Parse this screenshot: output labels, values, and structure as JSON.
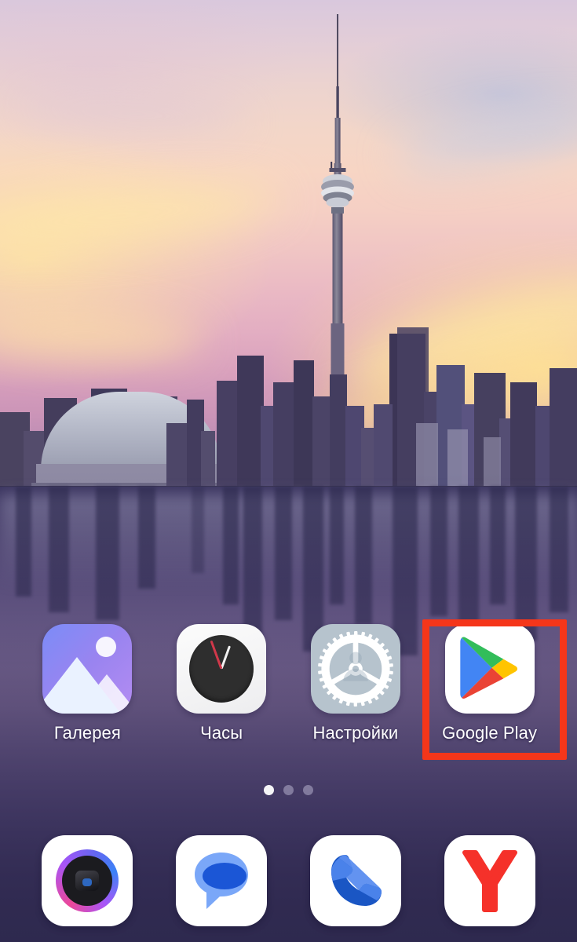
{
  "screen": {
    "type": "android-home-screen",
    "wallpaper_description": "Toronto skyline at sunset with CN Tower reflected in water",
    "background_color": "#2e2a55"
  },
  "app_grid": {
    "apps": [
      {
        "label": "Галерея",
        "icon": "gallery-icon",
        "highlighted": false
      },
      {
        "label": "Часы",
        "icon": "clock-icon",
        "highlighted": false
      },
      {
        "label": "Настройки",
        "icon": "settings-gear-icon",
        "highlighted": false
      },
      {
        "label": "Google Play",
        "icon": "google-play-icon",
        "highlighted": true
      }
    ]
  },
  "highlight": {
    "target": "Google Play",
    "color": "#f5361a",
    "border_width_px": 9
  },
  "page_indicator": {
    "total_pages": 3,
    "active_page": 1
  },
  "dock": {
    "apps": [
      {
        "name": "Camera",
        "icon": "camera-icon"
      },
      {
        "name": "Messages",
        "icon": "messages-bubble-icon"
      },
      {
        "name": "Phone",
        "icon": "phone-handset-icon"
      },
      {
        "name": "Yandex Browser",
        "icon": "yandex-y-icon"
      }
    ]
  },
  "colors": {
    "accent_highlight": "#f5361a",
    "label_text": "#ffffff",
    "dock_background": "#322d5c",
    "play_blue": "#2196f3",
    "play_green": "#32bd5a",
    "play_yellow": "#ffc400",
    "play_red": "#ea4335",
    "yandex_red": "#f5312a",
    "messages_blue_light": "#7aa7f8",
    "messages_blue_dark": "#1b56d6",
    "phone_blue": "#1a56c4"
  }
}
